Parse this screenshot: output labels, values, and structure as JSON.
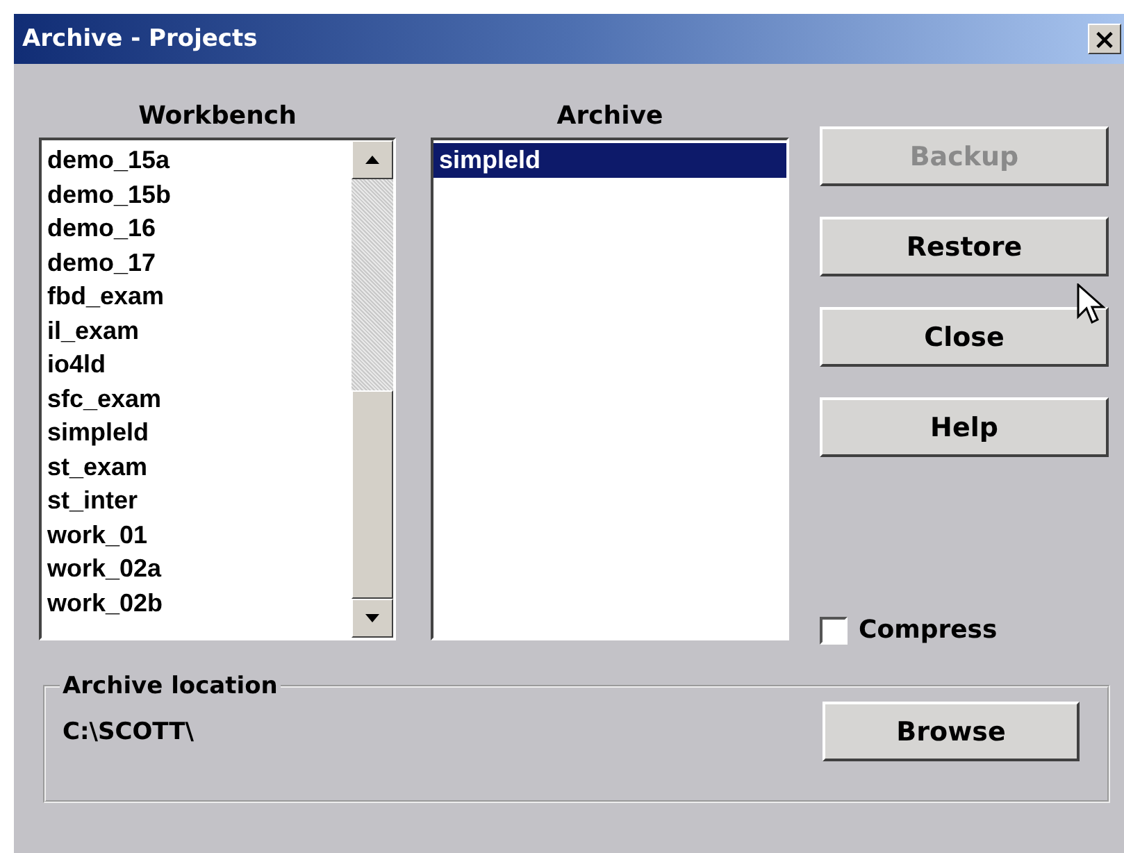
{
  "window": {
    "title": "Archive - Projects",
    "close_label": "×"
  },
  "workbench": {
    "label": "Workbench",
    "items": [
      {
        "label": "demo_15a",
        "selected": false
      },
      {
        "label": "demo_15b",
        "selected": false
      },
      {
        "label": "demo_16",
        "selected": false
      },
      {
        "label": "demo_17",
        "selected": false
      },
      {
        "label": "fbd_exam",
        "selected": false
      },
      {
        "label": "il_exam",
        "selected": false
      },
      {
        "label": "io4ld",
        "selected": false
      },
      {
        "label": "sfc_exam",
        "selected": false
      },
      {
        "label": "simpleld",
        "selected": false
      },
      {
        "label": "st_exam",
        "selected": false
      },
      {
        "label": "st_inter",
        "selected": false
      },
      {
        "label": "work_01",
        "selected": false
      },
      {
        "label": "work_02a",
        "selected": false
      },
      {
        "label": "work_02b",
        "selected": false
      }
    ]
  },
  "archive": {
    "label": "Archive",
    "items": [
      {
        "label": "simpleld",
        "selected": true
      }
    ]
  },
  "buttons": [
    {
      "label": "Backup",
      "disabled": true
    },
    {
      "label": "Restore",
      "disabled": false
    },
    {
      "label": "Close",
      "disabled": false
    },
    {
      "label": "Help",
      "disabled": false
    }
  ],
  "compress": {
    "label": "Compress",
    "checked": false
  },
  "location": {
    "label": "Archive location",
    "path": "C:\\SCOTT\\",
    "button": "Browse"
  }
}
